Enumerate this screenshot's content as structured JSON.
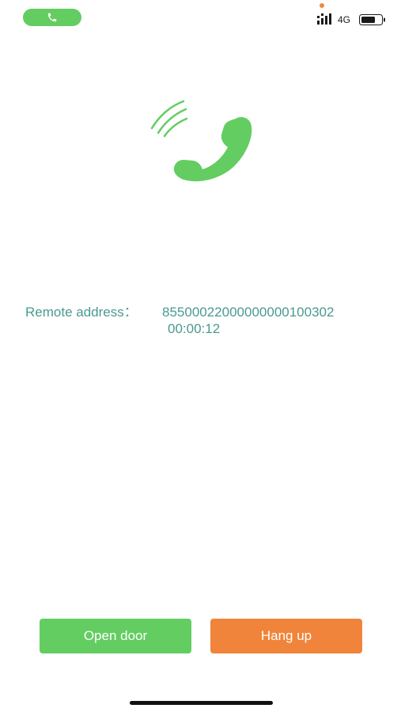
{
  "status_bar": {
    "network": "4G",
    "icons": [
      "phone-icon",
      "signal-icon",
      "battery-icon"
    ],
    "colors": {
      "call_pill": "#63cd61",
      "notification_dot": "#f08a3c"
    }
  },
  "call": {
    "icon": "ringing-phone-icon",
    "remote_address_label": "Remote address：",
    "remote_address_value": "85500022000000000100302",
    "duration": "00:00:12"
  },
  "actions": {
    "open_door_label": "Open door",
    "hang_up_label": "Hang up",
    "colors": {
      "open_door": "#63cd61",
      "hang_up": "#f0843a",
      "text": "#4a9a8f"
    }
  }
}
